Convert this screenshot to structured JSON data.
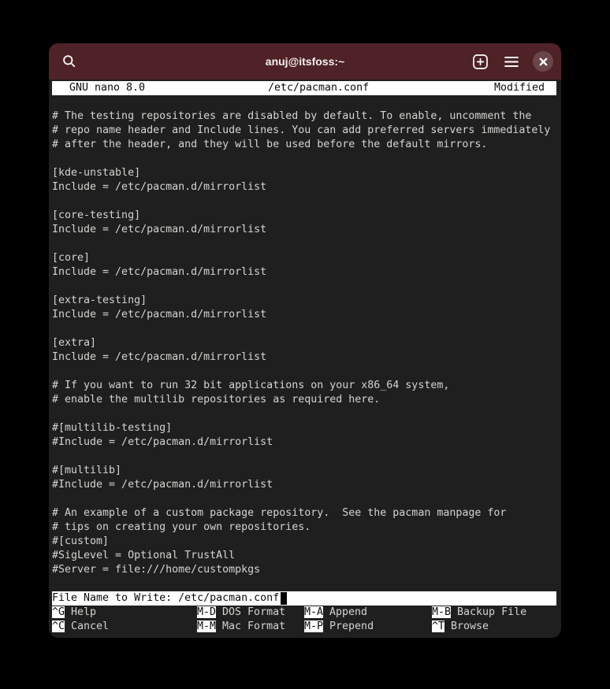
{
  "window": {
    "title": "anuj@itsfoss:~",
    "titlebar_buttons": [
      {
        "name": "search-icon"
      },
      {
        "name": "new-tab-icon"
      },
      {
        "name": "menu-icon"
      },
      {
        "name": "close-icon"
      }
    ]
  },
  "nano": {
    "header": {
      "app": "GNU nano 8.0",
      "file": "/etc/pacman.conf",
      "status": "Modified"
    },
    "lines": [
      "",
      "# The testing repositories are disabled by default. To enable, uncomment the",
      "# repo name header and Include lines. You can add preferred servers immediately",
      "# after the header, and they will be used before the default mirrors.",
      "",
      "[kde-unstable]",
      "Include = /etc/pacman.d/mirrorlist",
      "",
      "[core-testing]",
      "Include = /etc/pacman.d/mirrorlist",
      "",
      "[core]",
      "Include = /etc/pacman.d/mirrorlist",
      "",
      "[extra-testing]",
      "Include = /etc/pacman.d/mirrorlist",
      "",
      "[extra]",
      "Include = /etc/pacman.d/mirrorlist",
      "",
      "# If you want to run 32 bit applications on your x86_64 system,",
      "# enable the multilib repositories as required here.",
      "",
      "#[multilib-testing]",
      "#Include = /etc/pacman.d/mirrorlist",
      "",
      "#[multilib]",
      "#Include = /etc/pacman.d/mirrorlist",
      "",
      "# An example of a custom package repository.  See the pacman manpage for",
      "# tips on creating your own repositories.",
      "#[custom]",
      "#SigLevel = Optional TrustAll",
      "#Server = file:///home/custompkgs",
      ""
    ],
    "prompt": {
      "text": "File Name to Write: /etc/pacman.conf"
    },
    "shortcuts": [
      {
        "key": "^G",
        "label": "Help"
      },
      {
        "key": "M-D",
        "label": "DOS Format"
      },
      {
        "key": "M-A",
        "label": "Append"
      },
      {
        "key": "M-B",
        "label": "Backup File"
      },
      {
        "key": "^C",
        "label": "Cancel"
      },
      {
        "key": "M-M",
        "label": "Mac Format"
      },
      {
        "key": "M-P",
        "label": "Prepend"
      },
      {
        "key": "^T",
        "label": "Browse"
      }
    ]
  },
  "colors": {
    "titlebar_bg": "#4e2227",
    "close_button_bg": "#6a464b",
    "screen_bg": "#1f1f1f",
    "screen_text": "#d6d4d0",
    "bar_bg": "#ffffff",
    "bar_text": "#0a0a0a",
    "desktop_bg": "#000000"
  }
}
